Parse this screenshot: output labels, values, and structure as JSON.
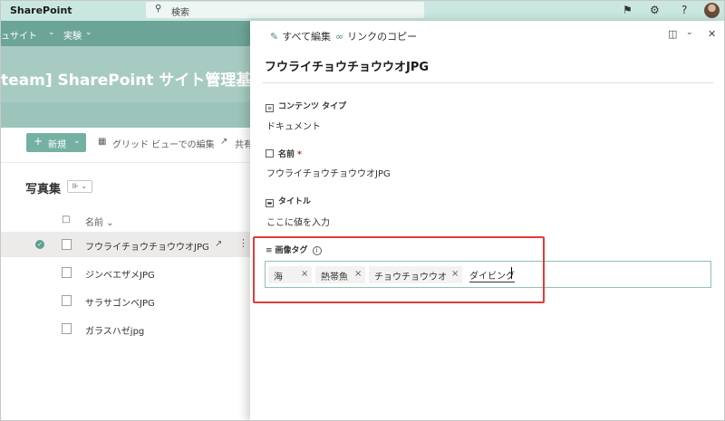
{
  "suitebar": {
    "brand": "SharePoint",
    "search_placeholder": "検索",
    "icons": [
      "megaphone-icon",
      "gear-icon",
      "help-icon"
    ],
    "help_label": "?"
  },
  "hub": {
    "items": [
      "ュサイト",
      "実験"
    ]
  },
  "site": {
    "title": "team] SharePoint サイト管理基礎"
  },
  "commandbar": {
    "new_label": "新規",
    "grid_edit_label": "グリッド ビューでの編集",
    "share_label": "共有"
  },
  "library": {
    "title": "写真集",
    "view_toggle": "⊪",
    "column_name": "名前",
    "files": [
      {
        "name": "フウライチョウチョウウオJPG",
        "selected": true
      },
      {
        "name": "ジンベエザメJPG",
        "selected": false
      },
      {
        "name": "サラサゴンベJPG",
        "selected": false
      },
      {
        "name": "ガラスハゼjpg",
        "selected": false
      }
    ]
  },
  "panel": {
    "edit_all": "すべて編集",
    "copy_link": "リンクのコピー",
    "title": "フウライチョウチョウウオJPG",
    "fields": {
      "content_type_label": "コンテンツ タイプ",
      "content_type_value": "ドキュメント",
      "name_label": "名前",
      "name_required": "*",
      "name_value": "フウライチョウチョウウオJPG",
      "title_label": "タイトル",
      "title_placeholder": "ここに値を入力",
      "image_tags_label": "画像タグ",
      "info_symbol": "i"
    },
    "tags": [
      "海",
      "熱帯魚",
      "チョウチョウウオ"
    ],
    "tag_remove": "×",
    "typed_text": "ダイビング"
  },
  "colors": {
    "suitebar": "#c9e7e0",
    "hub": "#6ca597",
    "site_header": "#a7cbc2",
    "accent": "#74b1a3",
    "highlight": "#e03c3c"
  }
}
